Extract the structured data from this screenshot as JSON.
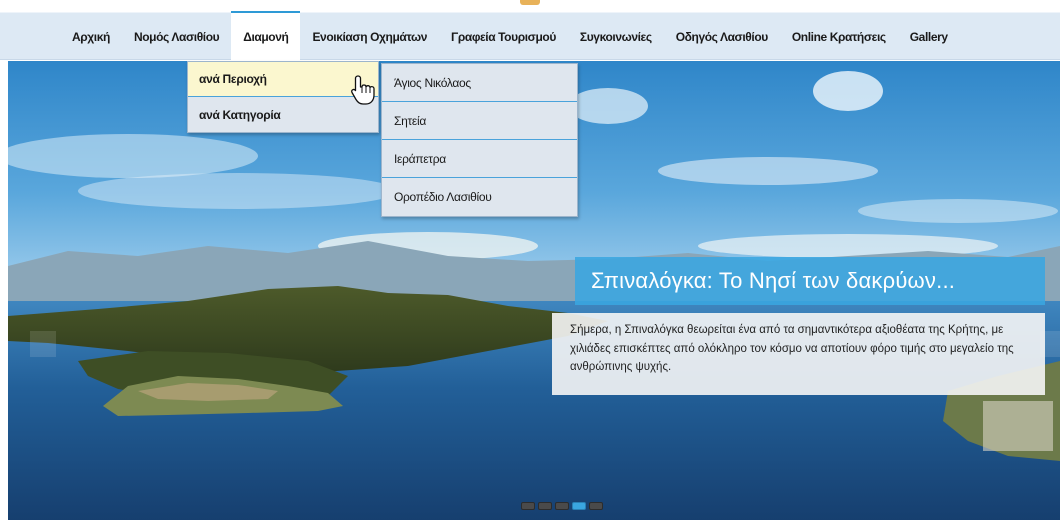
{
  "nav": {
    "items": [
      {
        "label": "Αρχική"
      },
      {
        "label": "Νομός Λασιθίου"
      },
      {
        "label": "Διαμονή",
        "active": true
      },
      {
        "label": "Ενοικίαση Οχημάτων"
      },
      {
        "label": "Γραφεία Τουρισμού"
      },
      {
        "label": "Συγκοινωνίες"
      },
      {
        "label": "Οδηγός Λασιθίου"
      },
      {
        "label": "Online Κρατήσεις"
      },
      {
        "label": "Gallery"
      }
    ]
  },
  "dropdown": {
    "items": [
      {
        "label": "ανά Περιοχή",
        "hover": true
      },
      {
        "label": "ανά Κατηγορία"
      }
    ]
  },
  "submenu": {
    "items": [
      {
        "label": "Άγιος Νικόλαος"
      },
      {
        "label": "Σητεία"
      },
      {
        "label": "Ιεράπετρα"
      },
      {
        "label": "Οροπέδιο Λασιθίου"
      }
    ]
  },
  "slide": {
    "title": "Σπιναλόγκα: Το Νησί των δακρύων...",
    "description": "Σήμερα, η Σπιναλόγκα θεωρείται ένα από τα σημαντικότερα αξιοθέατα της Κρήτης, με χιλιάδες επισκέπτες από ολόκληρο τον κόσμο να αποτίουν φόρο τιμής στο μεγαλείο της ανθρώπινης ψυχής."
  },
  "pager": {
    "count": 5,
    "active_index": 3
  },
  "colors": {
    "accent": "#3aa6e0",
    "nav_bg": "#dde9f4",
    "hover_bg": "#fbf7cf",
    "sea": "#1f5f97"
  },
  "icons": {
    "cursor": "hand-pointer-icon"
  }
}
